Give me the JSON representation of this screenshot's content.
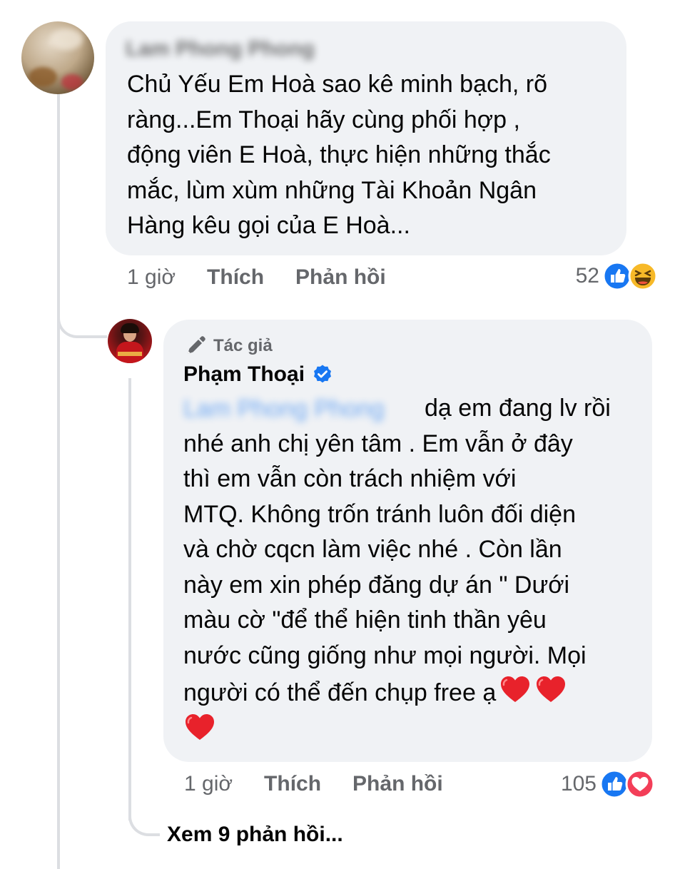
{
  "comment": {
    "author": "Lam Phong Phong",
    "text": "Chủ Yếu Em Hoà sao kê minh bạch, rõ\nràng...Em Thoại hãy cùng phối hợp ,\nđộng viên E Hoà, thực hiện những thắc\nmắc, lùm xùm những Tài Khoản Ngân\nHàng kêu gọi của E Hoà...",
    "time": "1 giờ",
    "like_label": "Thích",
    "reply_label": "Phản hồi",
    "reaction_count": "52",
    "reactions": [
      "like-icon",
      "haha-icon"
    ]
  },
  "reply": {
    "badge": "Tác giả",
    "author": "Phạm Thoại",
    "mention": "Lam Phong Phong",
    "text": "dạ em đang lv rồi\nnhé anh chị yên tâm . Em vẫn ở đây\nthì em vẫn còn trách nhiệm với\nMTQ. Không trốn tránh luôn đối diện\nvà chờ cqcn làm việc nhé . Còn lần\nnày em xin phép đăng dự án \" Dưới\nmàu cờ \"để thể hiện tinh thần yêu\nnước cũng giống như mọi người. Mọi\nngười có thể đến chụp free ạ",
    "time": "1 giờ",
    "like_label": "Thích",
    "reply_label": "Phản hồi",
    "reaction_count": "105",
    "reactions": [
      "like-icon",
      "love-icon"
    ]
  },
  "see_more_replies": "Xem 9 phản hồi...",
  "colors": {
    "bubble": "#f0f2f5",
    "meta_text": "#65676b",
    "accent_blue": "#1877f2",
    "love_red": "#f33e58",
    "heart_red": "#e8222b"
  }
}
